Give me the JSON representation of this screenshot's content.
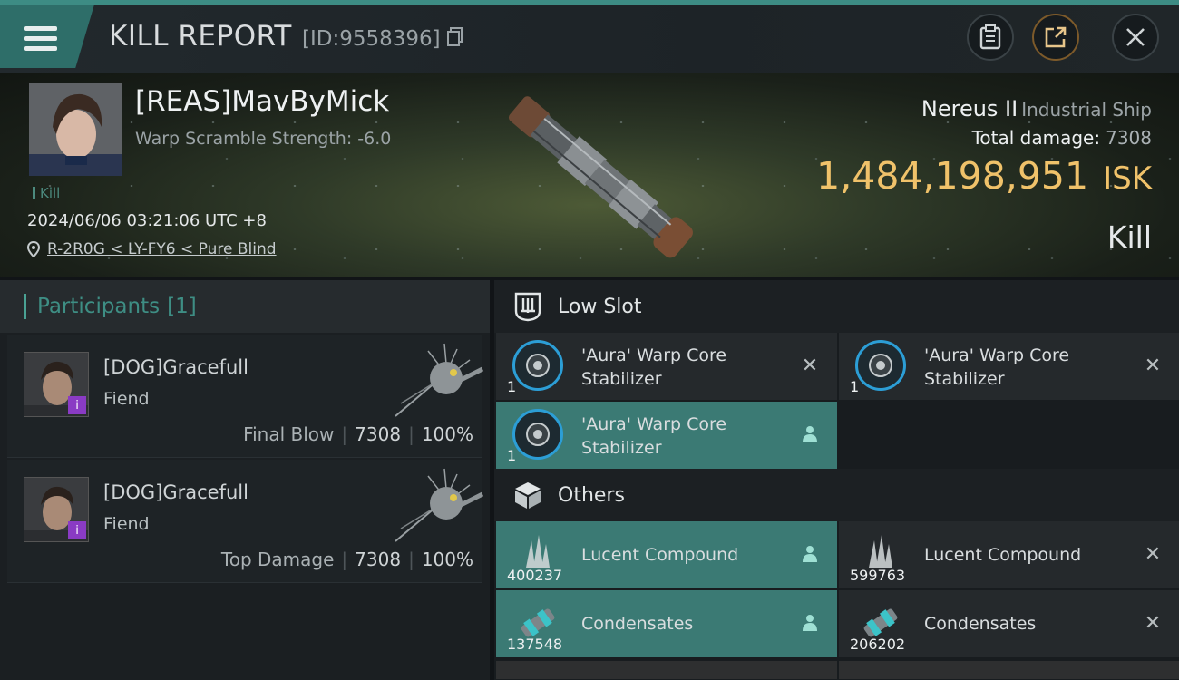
{
  "header": {
    "title": "KILL REPORT",
    "report_id": "[ID:9558396]",
    "buttons": {
      "clipboard": "clipboard-icon",
      "share": "share-icon",
      "close": "close-icon"
    }
  },
  "victim": {
    "name": "[REAS]MavByMick",
    "scramble": "Warp Scramble Strength: -6.0",
    "tag": "Kill",
    "timestamp": "2024/06/06 03:21:06 UTC +8",
    "location": "R-2R0G < LY-FY6 < Pure Blind",
    "ship_name": "Nereus II",
    "ship_type": "Industrial Ship",
    "total_damage_label": "Total damage:",
    "total_damage": "7308",
    "isk_value": "1,484,198,951",
    "isk_unit": "ISK",
    "result": "Kill"
  },
  "participants": {
    "title": "Participants",
    "count": "[1]",
    "entries": [
      {
        "name": "[DOG]Gracefull",
        "ship": "Fiend",
        "label": "Final Blow",
        "damage": "7308",
        "percent": "100%"
      },
      {
        "name": "[DOG]Gracefull",
        "ship": "Fiend",
        "label": "Top Damage",
        "damage": "7308",
        "percent": "100%"
      }
    ]
  },
  "fitting": {
    "low_slot": {
      "title": "Low Slot",
      "items": [
        {
          "name": "'Aura' Warp Core Stabilizer",
          "qty": "1",
          "action": "destroyed"
        },
        {
          "name": "'Aura' Warp Core Stabilizer",
          "qty": "1",
          "action": "destroyed"
        },
        {
          "name": "'Aura' Warp Core Stabilizer",
          "qty": "1",
          "action": "dropped"
        }
      ]
    },
    "others": {
      "title": "Others",
      "items": [
        {
          "name": "Lucent Compound",
          "qty": "400237",
          "action": "dropped"
        },
        {
          "name": "Lucent Compound",
          "qty": "599763",
          "action": "destroyed"
        },
        {
          "name": "Condensates",
          "qty": "137548",
          "action": "dropped"
        },
        {
          "name": "Condensates",
          "qty": "206202",
          "action": "destroyed"
        }
      ]
    }
  },
  "colors": {
    "accent": "#3b7a74",
    "isk": "#f0c26a",
    "badge": "#8a3bc4"
  }
}
